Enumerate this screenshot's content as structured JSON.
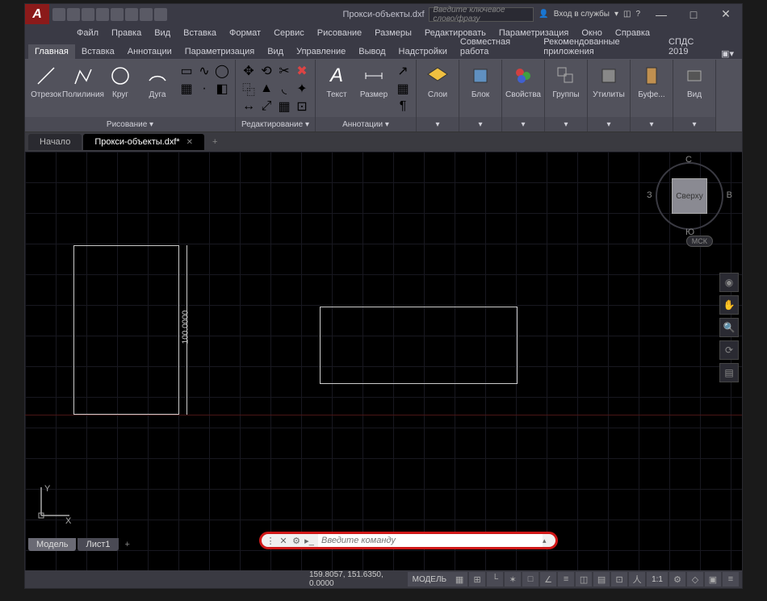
{
  "titlebar": {
    "logo": "A",
    "title": "Прокси-объекты.dxf",
    "search_placeholder": "Введите ключевое слово/фразу",
    "login": "Вход в службы",
    "min": "—",
    "max": "□",
    "close": "✕"
  },
  "menu": {
    "items": [
      "Файл",
      "Правка",
      "Вид",
      "Вставка",
      "Формат",
      "Сервис",
      "Рисование",
      "Размеры",
      "Редактировать",
      "Параметризация",
      "Окно",
      "Справка"
    ]
  },
  "ribbon_tabs": {
    "items": [
      "Главная",
      "Вставка",
      "Аннотации",
      "Параметризация",
      "Вид",
      "Управление",
      "Вывод",
      "Надстройки",
      "Совместная работа",
      "Рекомендованные приложения",
      "СПДС 2019"
    ],
    "active": 0
  },
  "ribbon": {
    "draw": {
      "label": "Рисование ▾",
      "line": "Отрезок",
      "polyline": "Полилиния",
      "circle": "Круг",
      "arc": "Дуга"
    },
    "edit": {
      "label": "Редактирование ▾"
    },
    "annot": {
      "label": "Аннотации ▾",
      "text": "Текст",
      "dim": "Размер"
    },
    "layers": {
      "label": "▾",
      "layer": "Слои"
    },
    "block": {
      "label": "▾",
      "block": "Блок"
    },
    "props": {
      "label": "▾",
      "props": "Свойства"
    },
    "groups": {
      "label": "▾",
      "groups": "Группы"
    },
    "utils": {
      "label": "▾",
      "utils": "Утилиты"
    },
    "clip": {
      "label": "▾",
      "clip": "Буфе..."
    },
    "view": {
      "label": "▾",
      "view": "Вид"
    }
  },
  "file_tabs": {
    "items": [
      {
        "label": "Начало",
        "active": false,
        "closable": false
      },
      {
        "label": "Прокси-объекты.dxf*",
        "active": true,
        "closable": true
      }
    ]
  },
  "canvas": {
    "dim_value": "100.0000",
    "ucs_x": "X",
    "ucs_y": "Y"
  },
  "viewcube": {
    "top": "Сверху",
    "n": "С",
    "s": "Ю",
    "e": "В",
    "w": "З",
    "mck": "МСК"
  },
  "command": {
    "placeholder": "Введите команду"
  },
  "bottom_tabs": {
    "items": [
      {
        "label": "Модель",
        "active": true
      },
      {
        "label": "Лист1",
        "active": false
      }
    ]
  },
  "statusbar": {
    "coords": "159.8057, 151.6350, 0.0000",
    "model": "МОДЕЛЬ",
    "scale": "1:1"
  }
}
